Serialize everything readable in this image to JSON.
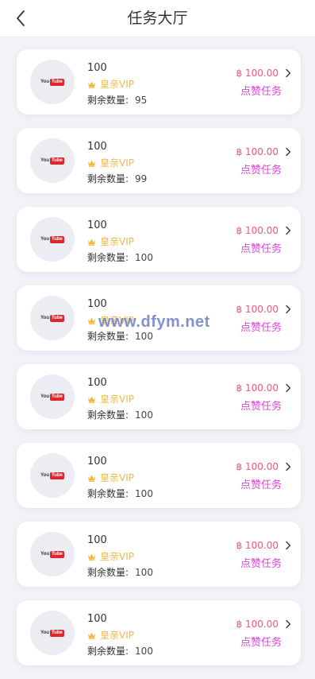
{
  "header": {
    "title": "任务大厅",
    "back_icon": "chevron-left-icon"
  },
  "colors": {
    "price": "#f25578",
    "task": "#e040e0",
    "vip": "#f1b842",
    "youtube_red": "#e0252b"
  },
  "tasks": [
    {
      "platform_icon": "youtube-logo",
      "logo_text_1": "You",
      "logo_text_2": "Tube",
      "name": "100",
      "level": "皇亲VIP",
      "remaining_label": "剩余数量:",
      "remaining": "95",
      "price": "฿ 100.00",
      "task_type": "点赞任务"
    },
    {
      "platform_icon": "youtube-logo",
      "logo_text_1": "You",
      "logo_text_2": "Tube",
      "name": "100",
      "level": "皇亲VIP",
      "remaining_label": "剩余数量:",
      "remaining": "99",
      "price": "฿ 100.00",
      "task_type": "点赞任务"
    },
    {
      "platform_icon": "youtube-logo",
      "logo_text_1": "You",
      "logo_text_2": "Tube",
      "name": "100",
      "level": "皇亲VIP",
      "remaining_label": "剩余数量:",
      "remaining": "100",
      "price": "฿ 100.00",
      "task_type": "点赞任务"
    },
    {
      "platform_icon": "youtube-logo",
      "logo_text_1": "You",
      "logo_text_2": "Tube",
      "name": "100",
      "level": "皇亲VIP",
      "remaining_label": "剩余数量:",
      "remaining": "100",
      "price": "฿ 100.00",
      "task_type": "点赞任务"
    },
    {
      "platform_icon": "youtube-logo",
      "logo_text_1": "You",
      "logo_text_2": "Tube",
      "name": "100",
      "level": "皇亲VIP",
      "remaining_label": "剩余数量:",
      "remaining": "100",
      "price": "฿ 100.00",
      "task_type": "点赞任务"
    },
    {
      "platform_icon": "youtube-logo",
      "logo_text_1": "You",
      "logo_text_2": "Tube",
      "name": "100",
      "level": "皇亲VIP",
      "remaining_label": "剩余数量:",
      "remaining": "100",
      "price": "฿ 100.00",
      "task_type": "点赞任务"
    },
    {
      "platform_icon": "youtube-logo",
      "logo_text_1": "You",
      "logo_text_2": "Tube",
      "name": "100",
      "level": "皇亲VIP",
      "remaining_label": "剩余数量:",
      "remaining": "100",
      "price": "฿ 100.00",
      "task_type": "点赞任务"
    },
    {
      "platform_icon": "youtube-logo",
      "logo_text_1": "You",
      "logo_text_2": "Tube",
      "name": "100",
      "level": "皇亲VIP",
      "remaining_label": "剩余数量:",
      "remaining": "100",
      "price": "฿ 100.00",
      "task_type": "点赞任务"
    }
  ],
  "watermark": "www.dfym.net"
}
